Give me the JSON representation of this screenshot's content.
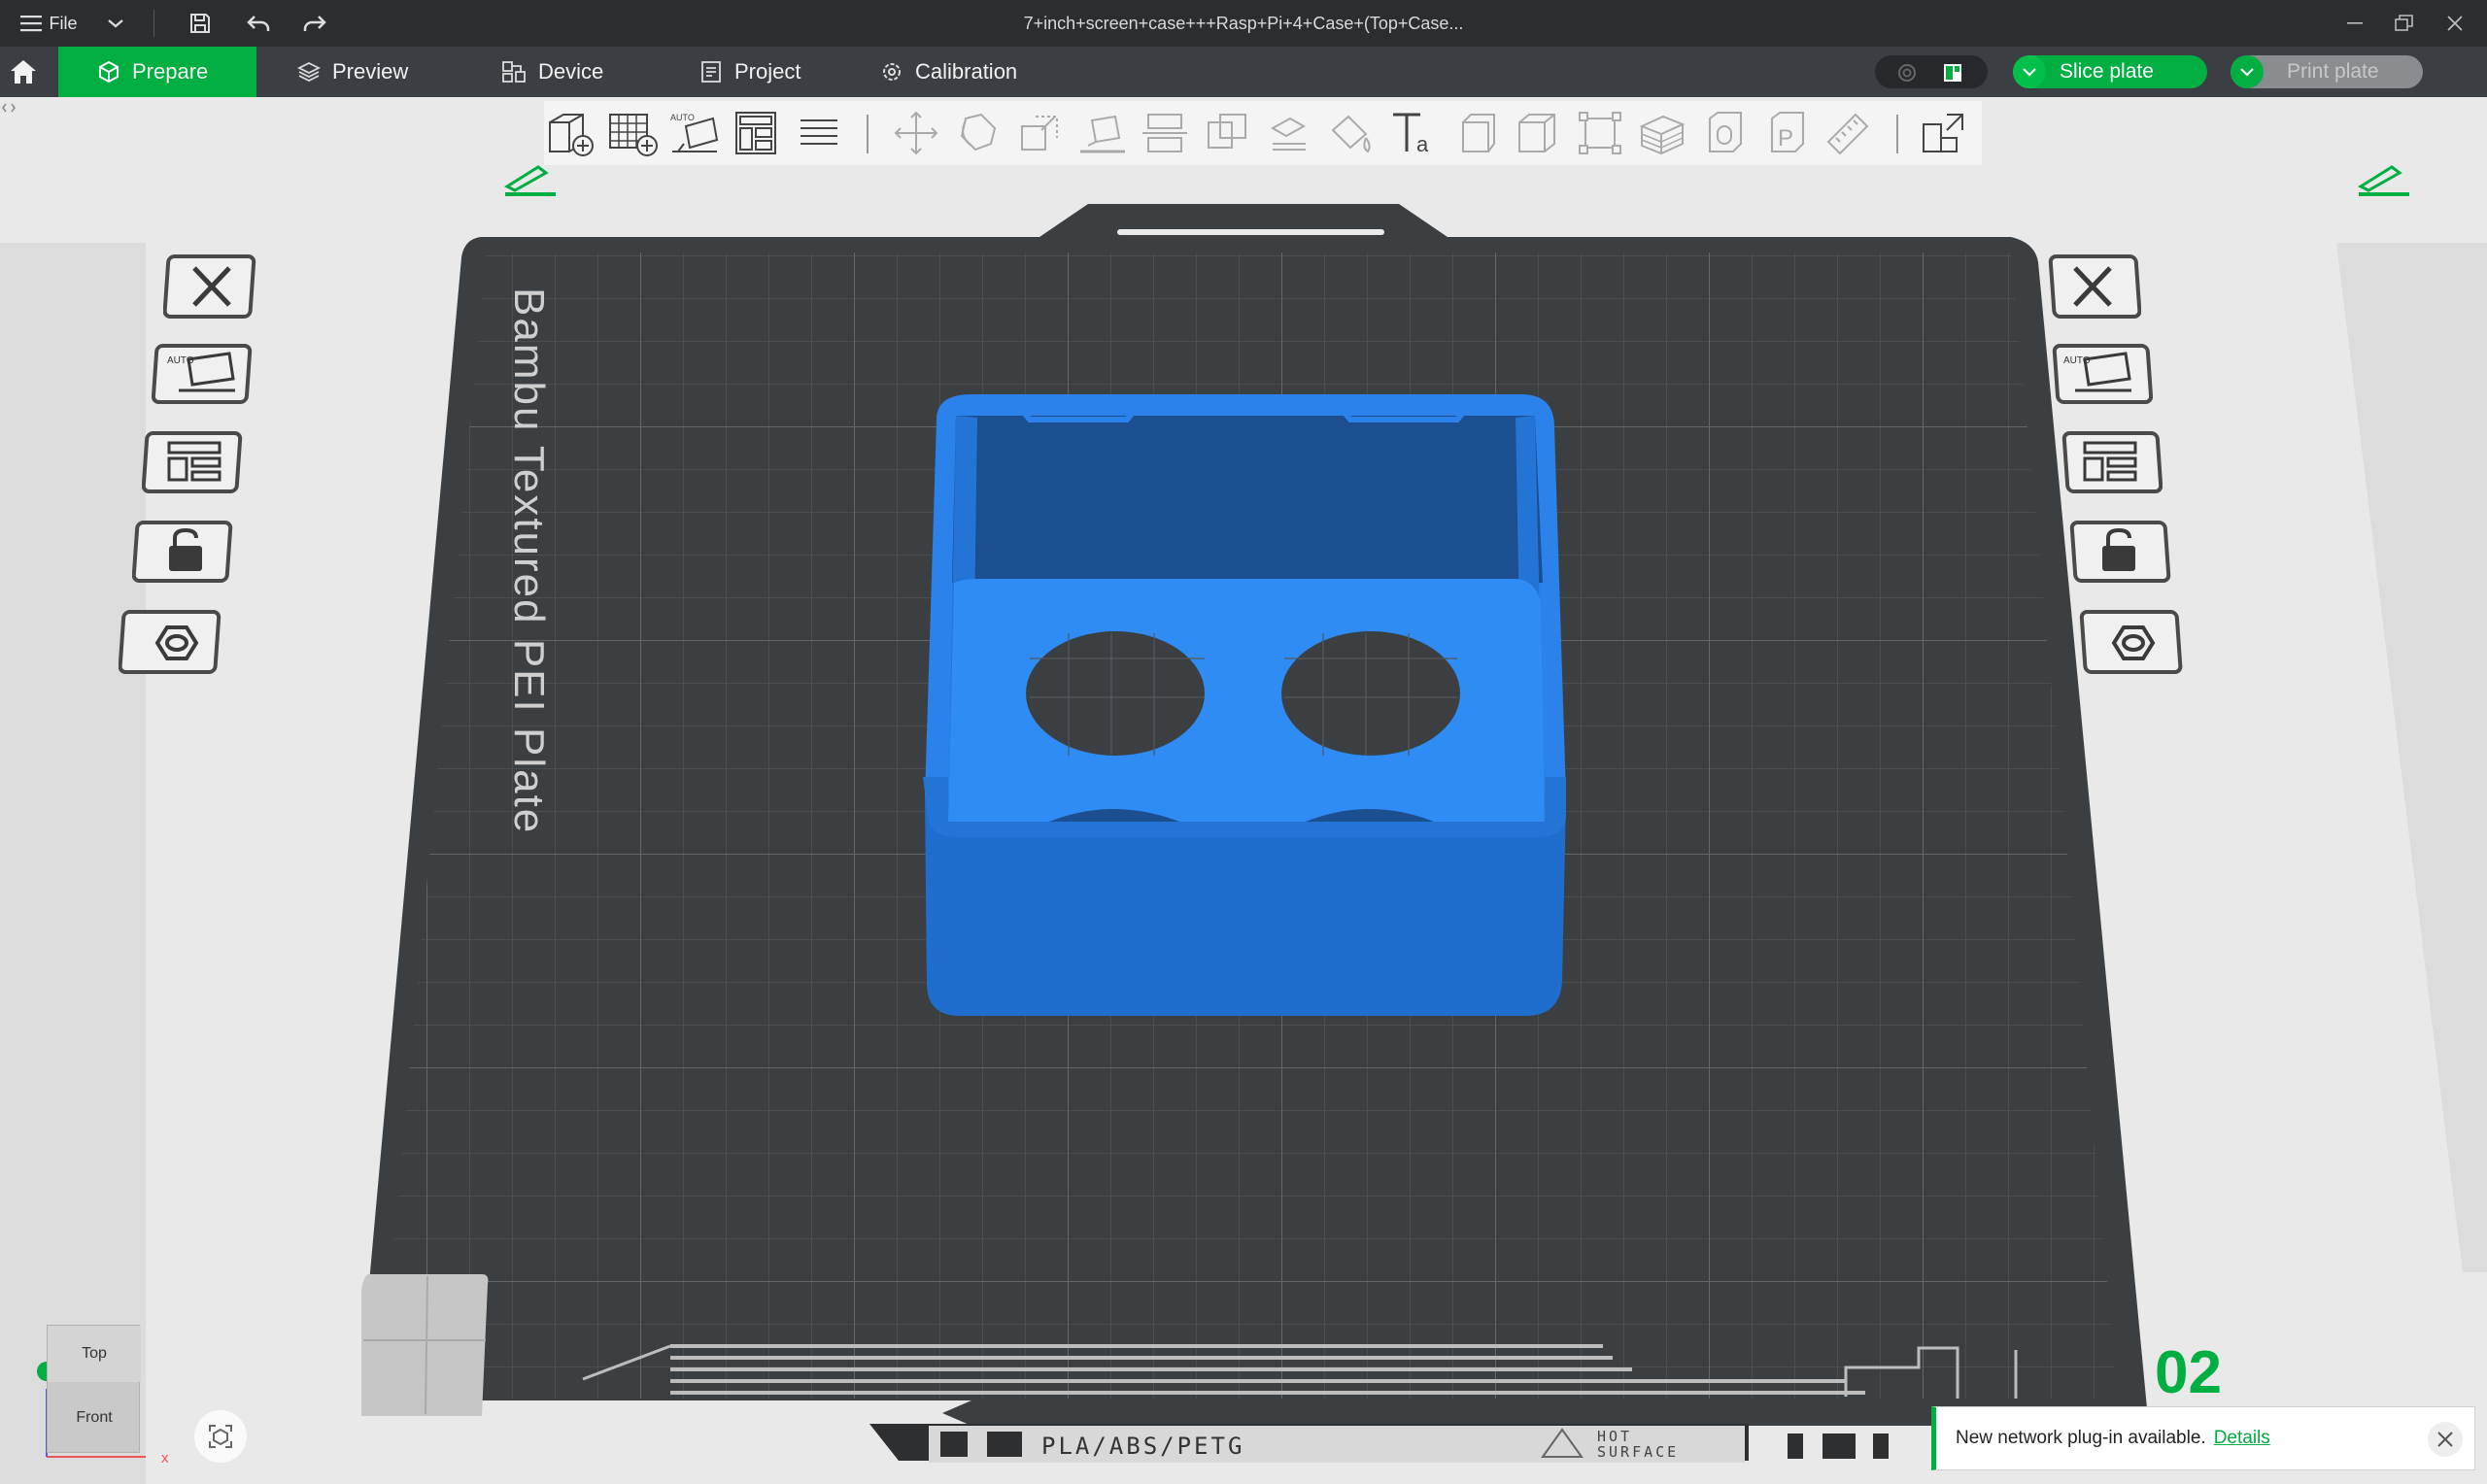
{
  "titlebar": {
    "file_label": "File",
    "title": "7+inch+screen+case+++Rasp+Pi+4+Case+(Top+Case..."
  },
  "tabs": [
    {
      "label": "Prepare",
      "active": true
    },
    {
      "label": "Preview"
    },
    {
      "label": "Device"
    },
    {
      "label": "Project"
    },
    {
      "label": "Calibration"
    }
  ],
  "actions": {
    "slice_label": "Slice plate",
    "print_label": "Print plate"
  },
  "plate": {
    "name": "Bambu Textured PEI Plate",
    "number": "02",
    "filaments": "PLA/ABS/PETG",
    "hot_surface_line1": "HOT",
    "hot_surface_line2": "SURFACE"
  },
  "viewcube": {
    "top": "Top",
    "front": "Front",
    "axis_x": "x"
  },
  "notification": {
    "text": "New network plug-in available.",
    "link": "Details"
  },
  "colors": {
    "accent": "#00ae42",
    "titlebar": "#2b2e31",
    "tabbar": "#3b3e42",
    "plate": "#3c3f42",
    "model": "#1e6fd0"
  },
  "toolbar_icons": [
    "add-object-icon",
    "add-plate-icon",
    "auto-orient-icon",
    "arrange-icon",
    "layers-icon",
    "move-icon",
    "rotate-icon",
    "scale-icon",
    "lay-on-face-icon",
    "cut-icon",
    "mesh-boolean-icon",
    "support-paint-icon",
    "seam-paint-icon",
    "text-icon",
    "measure-icon",
    "assembly-icon",
    "split-objects-icon",
    "split-parts-icon",
    "variable-layer-icon",
    "object-icon",
    "part-icon",
    "ruler-icon",
    "assemble-view-icon"
  ]
}
